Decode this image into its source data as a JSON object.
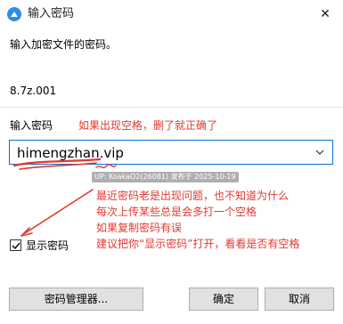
{
  "window": {
    "title": "输入密码",
    "close_glyph": "✕"
  },
  "dialog": {
    "prompt": "输入加密文件的密码。",
    "filename": "8.7z.001",
    "password_label": "输入密码",
    "password_value": "himengzhan.vip",
    "show_password_label": "显示密码",
    "show_password_checked": true
  },
  "buttons": {
    "manager": "密码管理器...",
    "ok": "确定",
    "cancel": "取消"
  },
  "annotations": {
    "top_note": "如果出现空格，删了就正确了",
    "watermark": "UP: KoakaO2(26081) 发布于 2025-10-19",
    "lines": [
      "最近密码老是出现问题，也不知道为什么",
      "每次上传某些总是会多打一个空格",
      "如果复制密码有误",
      "建议把你“显示密码”打开，看看是否有空格"
    ]
  },
  "colors": {
    "annotation": "#e03a30",
    "focus_border": "#0b6fd0",
    "app_icon": "#2d8cf0"
  }
}
